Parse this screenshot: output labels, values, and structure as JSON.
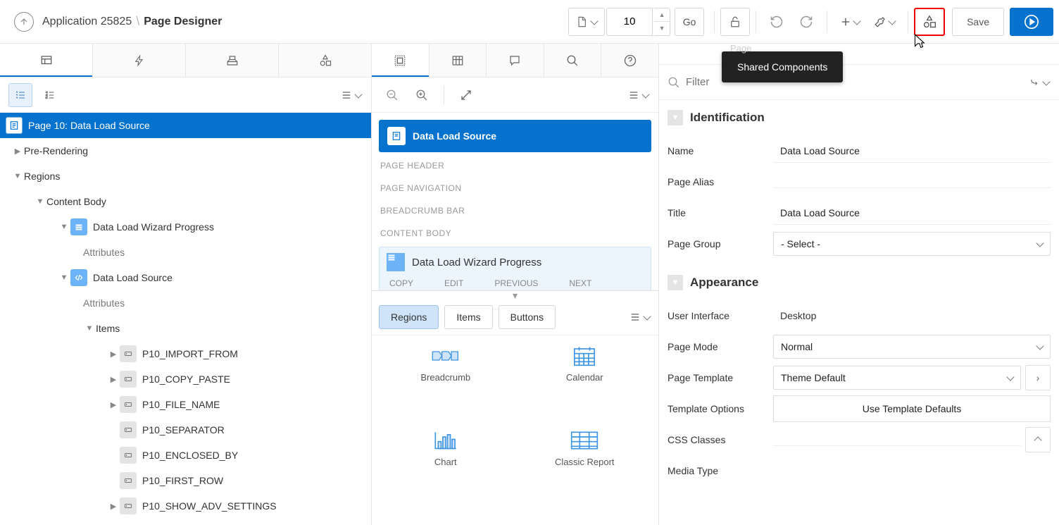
{
  "header": {
    "app": "Application 25825",
    "current": "Page Designer",
    "page_number": "10",
    "go": "Go",
    "save": "Save",
    "tooltip": "Shared Components",
    "hidden_tab": "Page"
  },
  "left": {
    "tree": {
      "root": "Page 10: Data Load Source",
      "prerendering": "Pre-Rendering",
      "regions": "Regions",
      "content_body": "Content Body",
      "wizard": "Data Load Wizard Progress",
      "wizard_attr": "Attributes",
      "source": "Data Load Source",
      "source_attr": "Attributes",
      "items": "Items",
      "item_list": [
        "P10_IMPORT_FROM",
        "P10_COPY_PASTE",
        "P10_FILE_NAME",
        "P10_SEPARATOR",
        "P10_ENCLOSED_BY",
        "P10_FIRST_ROW",
        "P10_SHOW_ADV_SETTINGS"
      ]
    }
  },
  "mid": {
    "region_primary": "Data Load Source",
    "labels": {
      "page_header": "PAGE HEADER",
      "page_nav": "PAGE NAVIGATION",
      "breadcrumb": "BREADCRUMB BAR",
      "content_body": "CONTENT BODY"
    },
    "wizard_region": "Data Load Wizard Progress",
    "buttons": [
      "COPY",
      "EDIT",
      "PREVIOUS",
      "NEXT"
    ],
    "gallery_tabs": {
      "regions": "Regions",
      "items": "Items",
      "buttons": "Buttons"
    },
    "gallery": [
      {
        "label": "Breadcrumb",
        "icon": "breadcrumb"
      },
      {
        "label": "Calendar",
        "icon": "calendar"
      },
      {
        "label": "Chart",
        "icon": "chart"
      },
      {
        "label": "Classic Report",
        "icon": "report"
      }
    ]
  },
  "right": {
    "filter_placeholder": "Filter",
    "sections": {
      "identification": "Identification",
      "appearance": "Appearance"
    },
    "identification": {
      "name_label": "Name",
      "name_value": "Data Load Source",
      "alias_label": "Page Alias",
      "alias_value": "",
      "title_label": "Title",
      "title_value": "Data Load Source",
      "group_label": "Page Group",
      "group_value": "- Select -"
    },
    "appearance": {
      "ui_label": "User Interface",
      "ui_value": "Desktop",
      "mode_label": "Page Mode",
      "mode_value": "Normal",
      "tmpl_label": "Page Template",
      "tmpl_value": "Theme Default",
      "opts_label": "Template Options",
      "opts_value": "Use Template Defaults",
      "css_label": "CSS Classes",
      "css_value": "",
      "media_label": "Media Type"
    }
  }
}
